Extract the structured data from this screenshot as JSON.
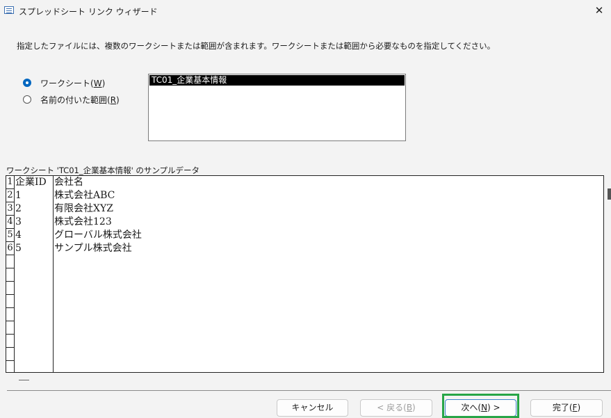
{
  "window": {
    "title": "スプレッドシート リンク ウィザード",
    "close_symbol": "✕",
    "app_icon": "table-icon"
  },
  "instruction": "指定したファイルには、複数のワークシートまたは範囲が含まれます。ワークシートまたは範囲から必要なものを指定してください。",
  "options": [
    {
      "label": "ワークシート(",
      "accel": "W",
      "suffix": ")",
      "checked": true
    },
    {
      "label": "名前の付いた範囲(",
      "accel": "R",
      "suffix": ")",
      "checked": false
    }
  ],
  "list": {
    "items": [
      "TC01_企業基本情報"
    ],
    "selected_index": 0
  },
  "sample": {
    "caption": "ワークシート 'TC01_企業基本情報' のサンプルデータ",
    "rows": [
      {
        "num": "1",
        "c1": "企業ID",
        "c2": "会社名"
      },
      {
        "num": "2",
        "c1": "1",
        "c2": "株式会社ABC"
      },
      {
        "num": "3",
        "c1": "2",
        "c2": "有限会社XYZ"
      },
      {
        "num": "4",
        "c1": "3",
        "c2": "株式会社123"
      },
      {
        "num": "5",
        "c1": "4",
        "c2": "グローバル株式会社"
      },
      {
        "num": "6",
        "c1": "5",
        "c2": "サンプル株式会社"
      }
    ]
  },
  "buttons": {
    "cancel": {
      "label": "キャンセル"
    },
    "back": {
      "label": "< 戻る(",
      "accel": "B",
      "suffix": ")"
    },
    "next": {
      "label": "次へ(",
      "accel": "N",
      "suffix": ") >"
    },
    "finish": {
      "label": "完了(",
      "accel": "F",
      "suffix": ")"
    }
  },
  "colors": {
    "accent": "#0067c0",
    "highlight": "#27a547",
    "selected_bg": "#000000"
  }
}
